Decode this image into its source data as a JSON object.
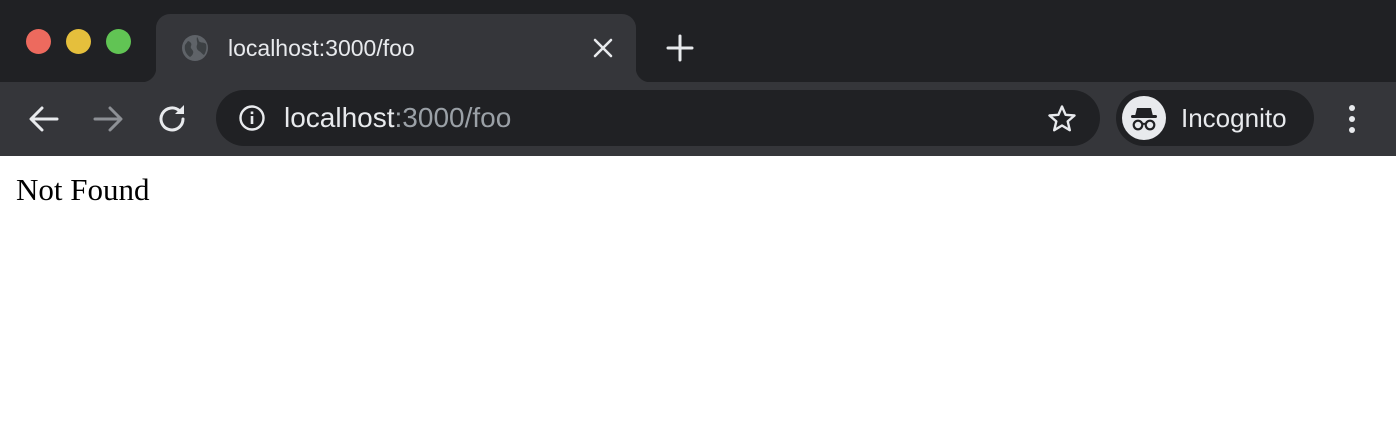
{
  "window": {
    "traffic_lights": {
      "close": "#ed6a5e",
      "minimize": "#e5bf3c",
      "zoom": "#61c454"
    }
  },
  "tab": {
    "title": "localhost:3000/foo",
    "favicon": "globe-icon",
    "close_icon": "close-icon"
  },
  "new_tab": {
    "icon": "plus-icon"
  },
  "toolbar": {
    "back_icon": "arrow-left-icon",
    "forward_icon": "arrow-right-icon",
    "reload_icon": "reload-icon",
    "menu_icon": "more-vertical-icon"
  },
  "omnibox": {
    "info_icon": "info-icon",
    "url_host": "localhost",
    "url_rest": ":3000/foo",
    "bookmark_icon": "star-outline-icon"
  },
  "profile": {
    "label": "Incognito",
    "icon": "incognito-icon"
  },
  "page": {
    "text": "Not Found"
  },
  "colors": {
    "tabstrip_bg": "#202124",
    "toolbar_bg": "#35363a",
    "omnibox_bg": "#202124",
    "text_primary": "#e8eaed",
    "text_secondary": "#9aa0a6",
    "page_bg": "#ffffff"
  }
}
